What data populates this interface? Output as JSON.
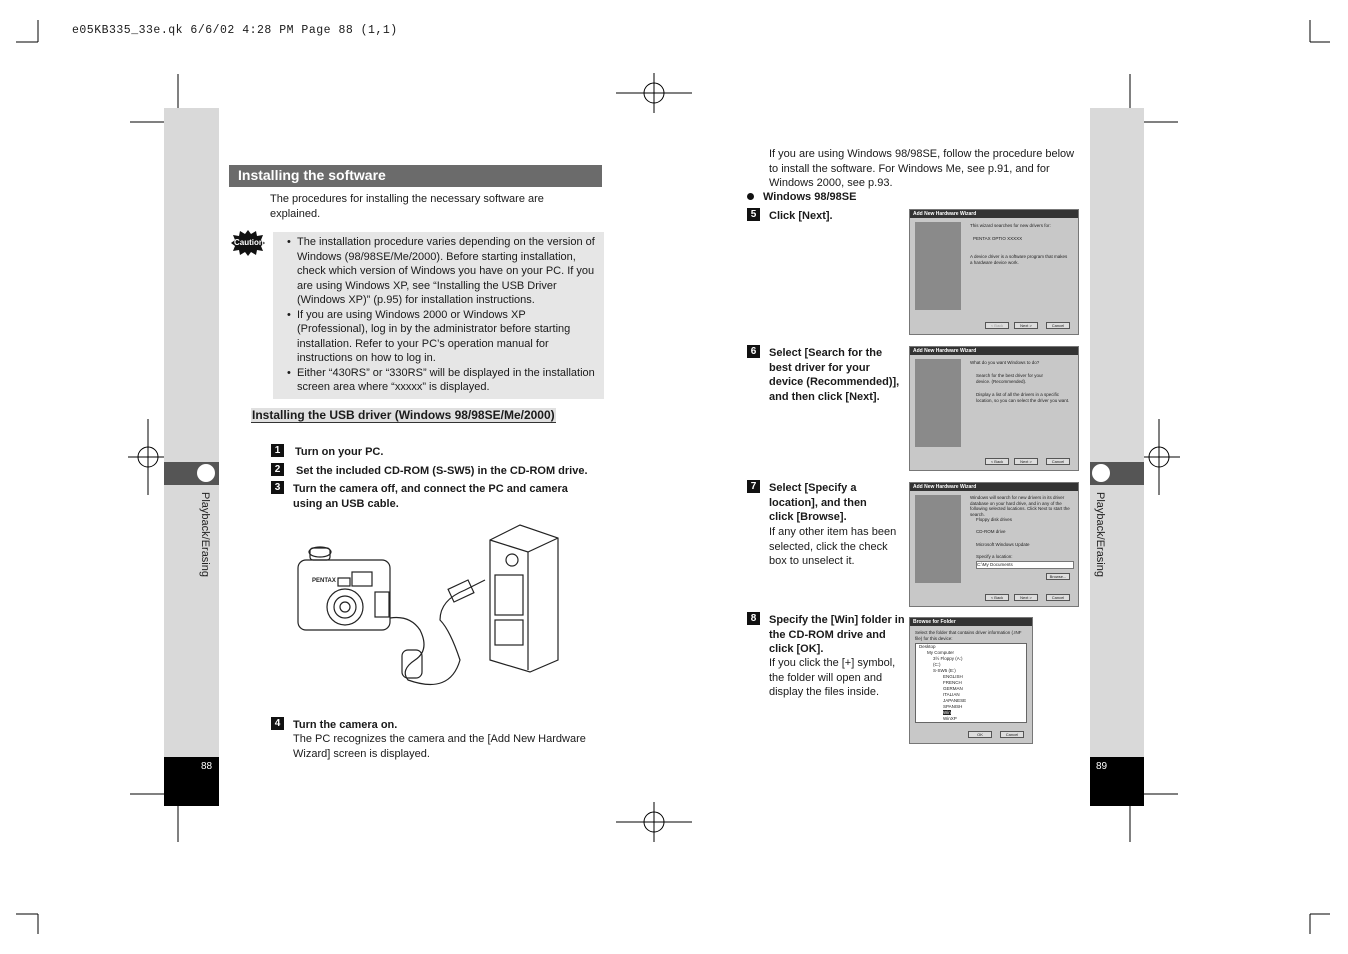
{
  "print_header": "e05KB335_33e.qk  6/6/02 4:28 PM  Page 88 (1,1)",
  "side_label": "Playback/Erasing",
  "left_page": {
    "page_number": "88",
    "section_title": "Installing the software",
    "intro": "The procedures for installing the necessary software are explained.",
    "caution_label": "Caution",
    "caution_items": [
      "The installation procedure varies depending on the version of Windows (98/98SE/Me/2000). Before starting installation, check which version of Windows you have on your PC. If you are using Windows XP, see “Installing the USB Driver (Windows XP)” (p.95) for installation instructions.",
      "If you are using Windows 2000 or Windows XP (Professional), log in by the administrator before starting installation. Refer to your PC’s operation manual for instructions on how to log in.",
      "Either “430RS” or “330RS” will be displayed in the installation screen area where “xxxxx” is displayed."
    ],
    "subheading": "Installing the USB driver (Windows 98/98SE/Me/2000)",
    "steps": [
      {
        "num": "1",
        "title": "Turn on your PC.",
        "body": ""
      },
      {
        "num": "2",
        "title": "Set the included CD-ROM (S-SW5) in the CD-ROM drive.",
        "body": ""
      },
      {
        "num": "3",
        "title": "Turn the camera off, and connect the PC and camera using an USB cable.",
        "body": ""
      },
      {
        "num": "4",
        "title": "Turn the camera on.",
        "body": "The PC recognizes the camera and the [Add New Hardware Wizard] screen is displayed."
      }
    ],
    "camera_brand": "PENTAX"
  },
  "right_page": {
    "page_number": "89",
    "intro": "If you are using Windows 98/98SE, follow the procedure below to install the software. For Windows Me, see p.91, and for Windows 2000, see p.93.",
    "os_heading": "Windows 98/98SE",
    "steps": [
      {
        "num": "5",
        "title": "Click [Next].",
        "body": ""
      },
      {
        "num": "6",
        "title": "Select [Search for the best driver for your device (Recommended)], and then click [Next].",
        "body": ""
      },
      {
        "num": "7",
        "title": "Select [Specify a location], and then click [Browse].",
        "body": "If any other item has been selected, click the check box to unselect it."
      },
      {
        "num": "8",
        "title": "Specify the [Win] folder in the CD-ROM drive and click [OK].",
        "body": "If you click the [+] symbol, the folder will open and display the files inside."
      }
    ],
    "dialogs": {
      "wizard_title": "Add New Hardware Wizard",
      "back": "< Back",
      "next": "Next >",
      "cancel": "Cancel",
      "d1": {
        "line1": "This wizard searches for new drivers for:",
        "device": "PENTAX OPTIO XXXXX",
        "line2": "A device driver is a software program that makes a hardware device work."
      },
      "d2": {
        "q": "What do you want Windows to do?",
        "opt1": "Search for the best driver for your device. (Recommended).",
        "opt2": "Display a list of all the drivers in a specific location, so you can select the driver you want."
      },
      "d3": {
        "text": "Windows will search for new drivers in its driver database on your hard drive, and in any of the following selected locations. Click Next to start the search.",
        "c1": "Floppy disk drives",
        "c2": "CD-ROM drive",
        "c3": "Microsoft Windows Update",
        "c4": "Specify a location:",
        "path": "C:\\My Documents",
        "browse": "Browse..."
      },
      "d4": {
        "title": "Browse for Folder",
        "text": "Select the folder that contains driver information (.INF file) for this device:",
        "tree": [
          "Desktop",
          "My Computer",
          "3½ Floppy (A:)",
          "(C:)",
          "S-SW5 (E:)",
          "ENGLISH",
          "FRENCH",
          "GERMAN",
          "ITALIAN",
          "JAPANESE",
          "SPANISH",
          "Win",
          "WinXP"
        ],
        "ok": "OK",
        "cancel": "Cancel"
      }
    }
  }
}
